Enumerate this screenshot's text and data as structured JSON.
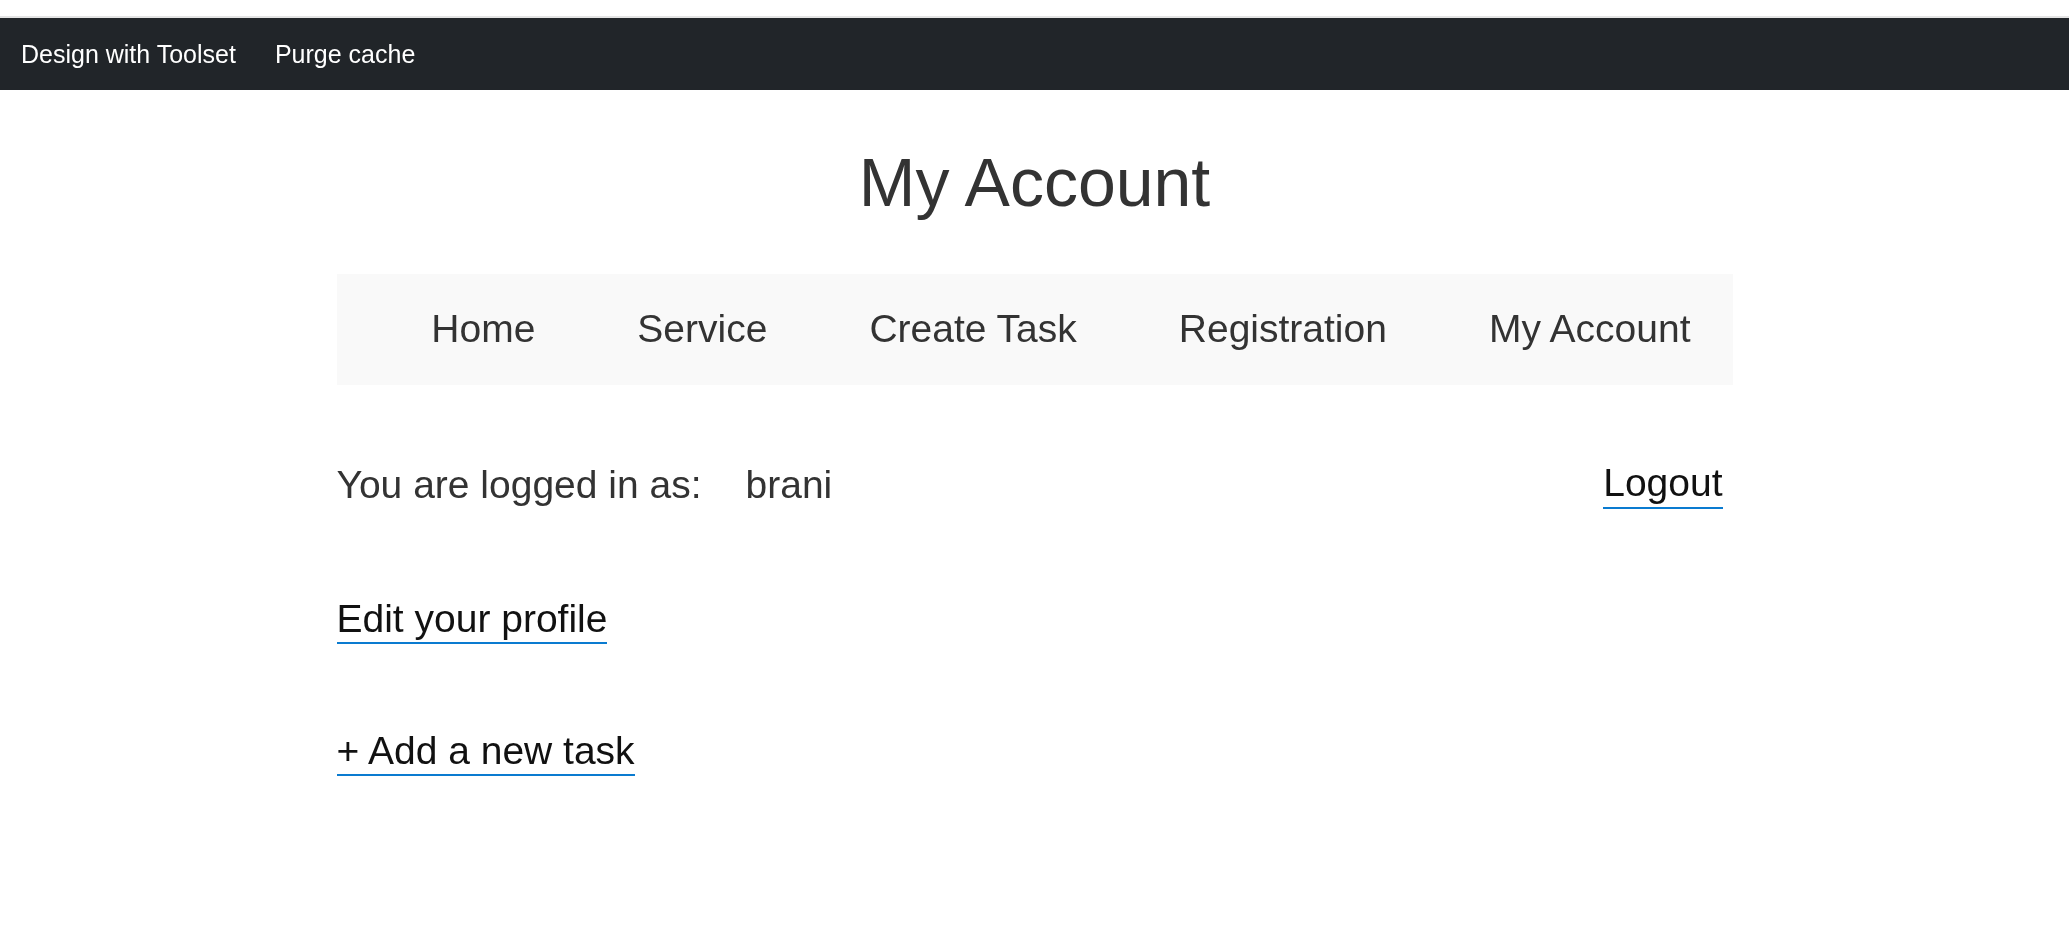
{
  "admin_bar": {
    "items": [
      "Design with Toolset",
      "Purge cache"
    ]
  },
  "page": {
    "title": "My Account"
  },
  "nav": {
    "items": [
      "Home",
      "Service",
      "Create Task",
      "Registration",
      "My Account"
    ]
  },
  "account": {
    "logged_in_label": "You are logged in as:",
    "username": "brani",
    "logout_link": "Logout",
    "edit_profile_link": "Edit your profile",
    "add_task_link": "+ Add a new task"
  }
}
